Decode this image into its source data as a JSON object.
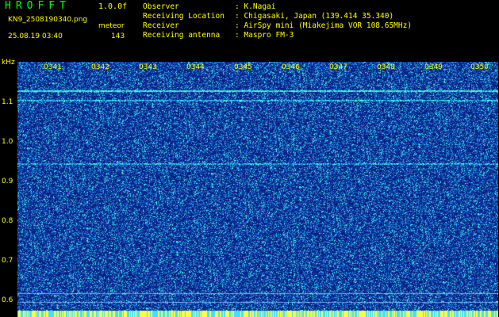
{
  "header": {
    "app_title": "HROFFT",
    "version": "1.0.0f",
    "filename": "KN9_2508190340.png",
    "meteor_label": "meteor",
    "datetime": "25.08.19 03:40",
    "meteor_count": "143"
  },
  "info": [
    {
      "label": "Observer",
      "value": ": K.Nagai"
    },
    {
      "label": "Receiving Location",
      "value": ": Chigasaki, Japan (139.414 35.340)"
    },
    {
      "label": "Receiver",
      "value": ": AirSpy mini (Miakejima VOR 108.65MHz)"
    },
    {
      "label": "Receiving antenna",
      "value": ": Maspro FM-3"
    }
  ],
  "axis": {
    "unit": "kHz",
    "freq_labels": [
      "1.1",
      "1.0",
      "0.9",
      "0.8",
      "0.7",
      "0.6"
    ],
    "time_labels": [
      "0341",
      "0342",
      "0343",
      "0344",
      "0345",
      "0346",
      "0347",
      "0348",
      "0349",
      "0350"
    ]
  },
  "colors": {
    "background": "#000000",
    "text": "#ffff00",
    "title": "#00ff00",
    "spectrogram_base": "#0a1a80"
  }
}
